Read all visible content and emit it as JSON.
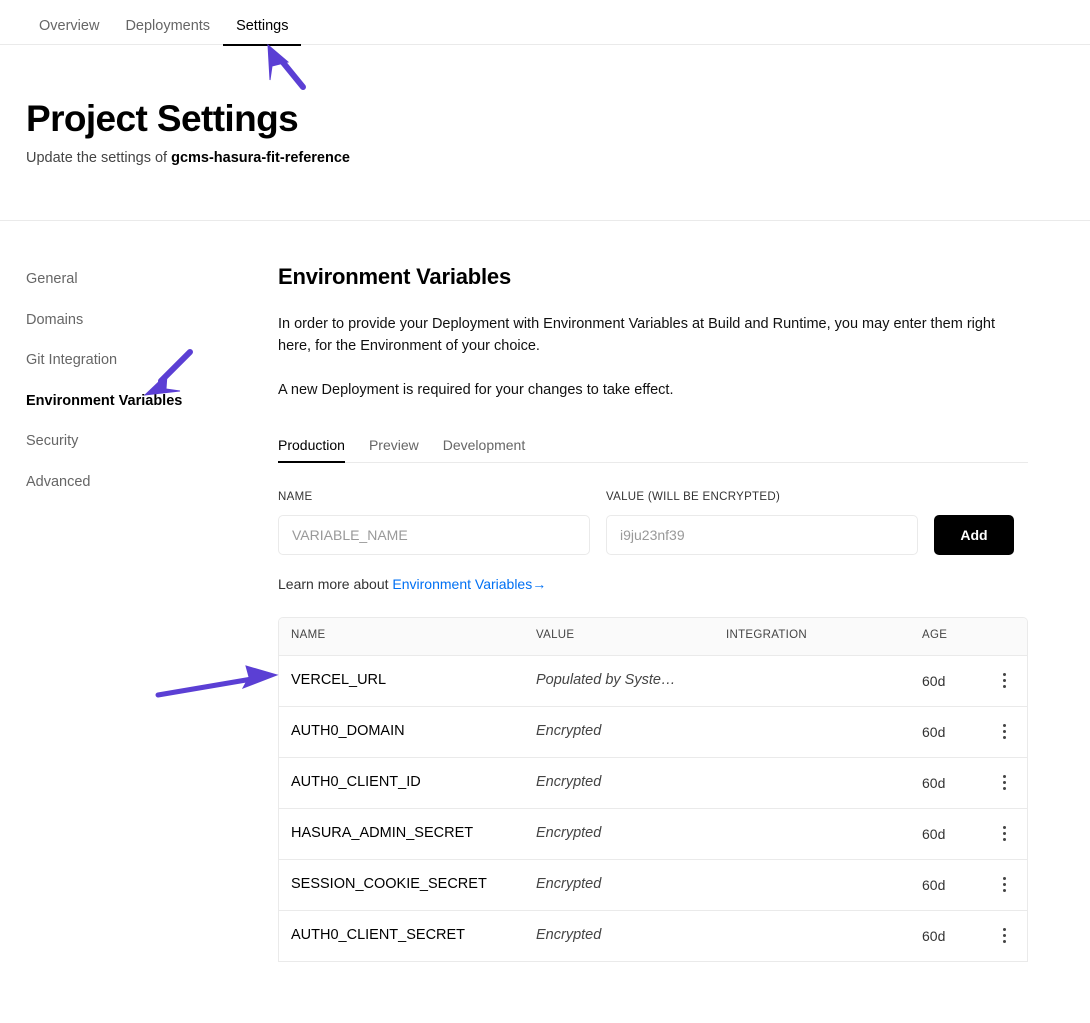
{
  "topbar": {
    "tabs": [
      {
        "label": "Overview",
        "active": false
      },
      {
        "label": "Deployments",
        "active": false
      },
      {
        "label": "Settings",
        "active": true
      }
    ]
  },
  "header": {
    "title": "Project Settings",
    "subtitle_prefix": "Update the settings of ",
    "project_name": "gcms-hasura-fit-reference"
  },
  "sidebar": {
    "items": [
      {
        "label": "General",
        "active": false
      },
      {
        "label": "Domains",
        "active": false
      },
      {
        "label": "Git Integration",
        "active": false
      },
      {
        "label": "Environment Variables",
        "active": true
      },
      {
        "label": "Security",
        "active": false
      },
      {
        "label": "Advanced",
        "active": false
      }
    ]
  },
  "main": {
    "section_title": "Environment Variables",
    "paragraph_1": "In order to provide your Deployment with Environment Variables at Build and Runtime, you may enter them right here, for the Environment of your choice.",
    "paragraph_2": "A new Deployment is required for your changes to take effect.",
    "env_tabs": [
      {
        "label": "Production",
        "active": true
      },
      {
        "label": "Preview",
        "active": false
      },
      {
        "label": "Development",
        "active": false
      }
    ],
    "form": {
      "name_label": "NAME",
      "name_value": "",
      "name_placeholder": "VARIABLE_NAME",
      "value_label": "VALUE (WILL BE ENCRYPTED)",
      "value_value": "",
      "value_placeholder": "i9ju23nf39",
      "add_label": "Add"
    },
    "learn_more": {
      "prefix": "Learn more about ",
      "link_text": "Environment Variables",
      "arrow": "→"
    },
    "table": {
      "columns": [
        "NAME",
        "VALUE",
        "INTEGRATION",
        "AGE"
      ],
      "rows": [
        {
          "name": "VERCEL_URL",
          "value": "Populated by Syste…",
          "integration": "",
          "age": "60d",
          "menu": "more-options"
        },
        {
          "name": "AUTH0_DOMAIN",
          "value": "Encrypted",
          "integration": "",
          "age": "60d",
          "menu": "more-options"
        },
        {
          "name": "AUTH0_CLIENT_ID",
          "value": "Encrypted",
          "integration": "",
          "age": "60d",
          "menu": "more-options"
        },
        {
          "name": "HASURA_ADMIN_SECRET",
          "value": "Encrypted",
          "integration": "",
          "age": "60d",
          "menu": "more-options"
        },
        {
          "name": "SESSION_COOKIE_SECRET",
          "value": "Encrypted",
          "integration": "",
          "age": "60d",
          "menu": "more-options"
        },
        {
          "name": "AUTH0_CLIENT_SECRET",
          "value": "Encrypted",
          "integration": "",
          "age": "60d",
          "menu": "more-options"
        }
      ]
    }
  },
  "annotations": {
    "color": "#5B3FD4",
    "arrows": [
      {
        "name": "arrow-to-settings-tab",
        "points_to": "Settings"
      },
      {
        "name": "arrow-to-environment-variables-nav",
        "points_to": "Environment Variables"
      },
      {
        "name": "arrow-to-vercel-url-row",
        "points_to": "VERCEL_URL"
      }
    ]
  }
}
